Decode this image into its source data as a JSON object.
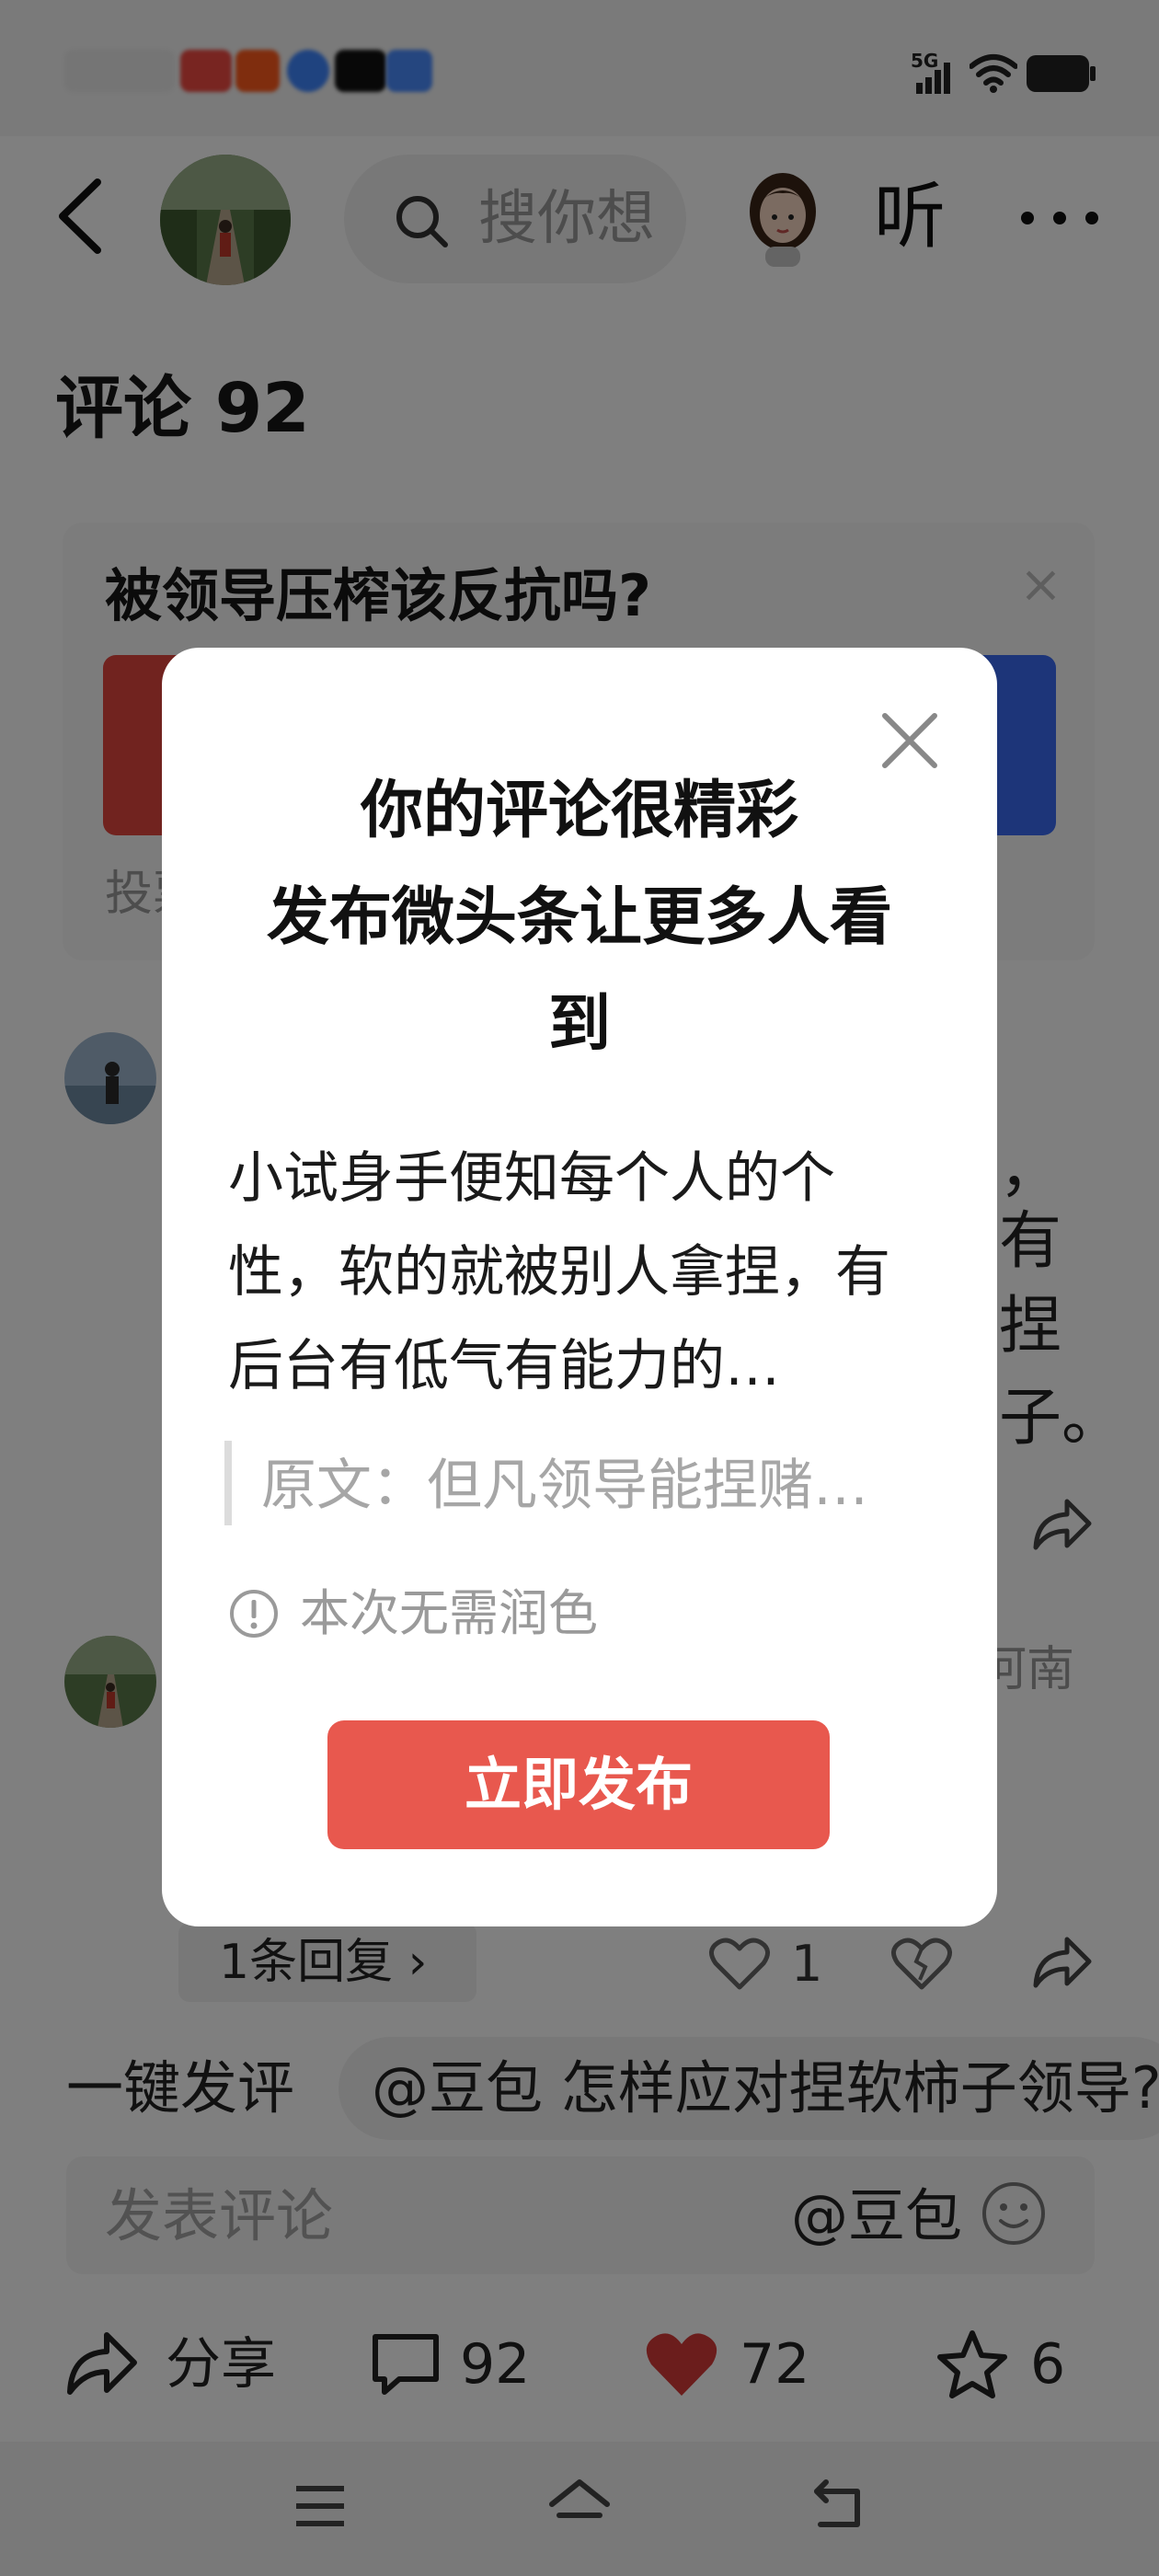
{
  "colors": {
    "overlay": "#000000",
    "publish_button": "#e8584e",
    "vote_red": "#e2463f",
    "vote_blue": "#3a6af2",
    "liked_heart": "#d63a38"
  },
  "status_bar": {
    "signal": "5G",
    "icons": [
      "signal-icon",
      "wifi-icon",
      "battery-icon"
    ]
  },
  "header": {
    "search_placeholder": "搜你想",
    "listen_label": "听",
    "icons": [
      "back-arrow-icon",
      "search-icon",
      "more-dots-icon"
    ]
  },
  "page": {
    "title": "评论 92"
  },
  "poll": {
    "question": "被领导压榨该反抗吗?",
    "close_label": "×",
    "footer": "投票"
  },
  "comments": [
    {
      "visible_fragments": [
        "，",
        "有",
        "捏",
        "子。"
      ]
    },
    {
      "location": "河南",
      "reply_label": "1条回复 ›",
      "likes": "1"
    }
  ],
  "one_click": {
    "label": "一键发评",
    "suggestion": "@豆包 怎样应对捏软柿子领导?"
  },
  "comment_input": {
    "placeholder": "发表评论",
    "mention": "@豆包"
  },
  "action_bar": {
    "share_label": "分享",
    "comments_count": "92",
    "likes_count": "72",
    "favorites_count": "6"
  },
  "dialog": {
    "title_line1": "你的评论很精彩",
    "title_line2": "发布微头条让更多人看",
    "title_line3": "到",
    "body": "小试身手便知每个人的个性，软的就被别人拿捏，有后台有低气有能力的…",
    "quote": "原文：但凡领导能捏赌…",
    "info": "本次无需润色",
    "publish_label": "立即发布"
  }
}
